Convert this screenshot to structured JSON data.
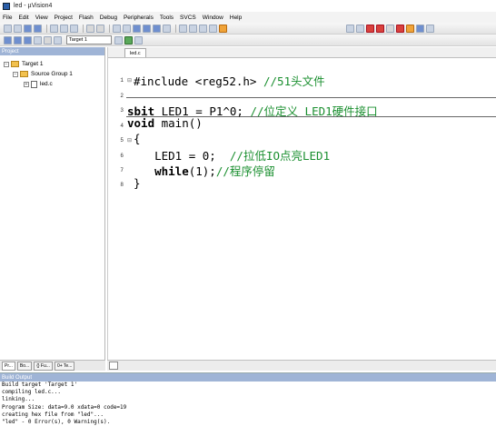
{
  "window": {
    "title": "led - µVision4"
  },
  "menu": [
    "File",
    "Edit",
    "View",
    "Project",
    "Flash",
    "Debug",
    "Peripherals",
    "Tools",
    "SVCS",
    "Window",
    "Help"
  ],
  "toolbar2": {
    "target": "Target 1"
  },
  "project": {
    "header": "Project",
    "tree": {
      "root": "Target 1",
      "group": "Source Group 1",
      "file": "led.c"
    },
    "tabs": [
      "Pr...",
      "Bo...",
      "{} Fu...",
      "0+ Te..."
    ]
  },
  "editor": {
    "tab": "led.c",
    "lines": [
      {
        "n": "1",
        "text": "#include <reg52.h> //51头文件"
      },
      {
        "n": "2",
        "text": ""
      },
      {
        "n": "3",
        "text": "sbit LED1 = P1^0; //位定义 LED1硬件接口"
      },
      {
        "n": "4",
        "text": "void main()"
      },
      {
        "n": "5",
        "text": "{"
      },
      {
        "n": "6",
        "text": "    LED1 = 0;  //拉低IO点亮LED1"
      },
      {
        "n": "7",
        "text": "    while(1);//程序停留"
      },
      {
        "n": "8",
        "text": "}"
      }
    ],
    "code": {
      "l1a": "#include <reg52.h> ",
      "l1c": "//51头文件",
      "l3a": "sbit",
      "l3b": " LED1 = P1^0; ",
      "l3c": "//位定义 LED1硬件接口",
      "l4a": "void",
      "l4b": " main()",
      "l5": "{",
      "l6a": "    LED1 = 0;  ",
      "l6c": "//拉低IO点亮LED1",
      "l7a": "    while",
      "l7b": "(1);",
      "l7c": "//程序停留",
      "l8": "}"
    }
  },
  "output": {
    "header": "Build Output",
    "lines": [
      "Build target 'Target 1'",
      "compiling led.c...",
      "linking...",
      "Program Size: data=9.0 xdata=0 code=19",
      "creating hex file from \"led\"...",
      "\"led\" - 0 Error(s), 0 Warning(s)."
    ]
  }
}
